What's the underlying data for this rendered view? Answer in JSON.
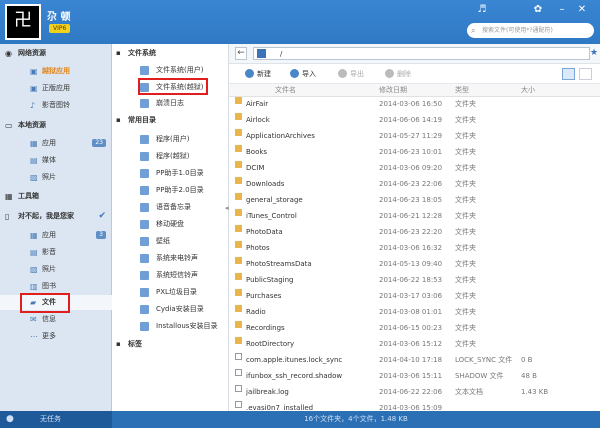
{
  "user": {
    "avatar_glyph": "卍",
    "name": "尕 顿",
    "vip": "VIP6"
  },
  "top_icons": {
    "music": "♬",
    "skin": "✿",
    "minimize": "–",
    "close": "✕"
  },
  "search": {
    "placeholder": "搜索文件(可使用*?通配符)",
    "icon": "search-icon"
  },
  "left_nav": {
    "network": {
      "label": "网络资源",
      "items": [
        {
          "label": "越狱应用",
          "active": true
        },
        {
          "label": "正版应用"
        },
        {
          "label": "影音图铃"
        }
      ]
    },
    "local": {
      "label": "本地资源",
      "items": [
        {
          "label": "应用",
          "badge": "23"
        },
        {
          "label": "媒体"
        },
        {
          "label": "照片"
        }
      ]
    },
    "toolbox": {
      "label": "工具箱"
    },
    "device": {
      "label": "对不起，我是您家",
      "items": [
        {
          "label": "应用",
          "badge": "3"
        },
        {
          "label": "影音"
        },
        {
          "label": "照片"
        },
        {
          "label": "图书"
        },
        {
          "label": "文件",
          "selected": true
        },
        {
          "label": "信息"
        },
        {
          "label": "更多"
        }
      ]
    }
  },
  "bottom_left": {
    "label": "无任务"
  },
  "tree": {
    "fs_header": "文件系统",
    "fs_items": [
      "文件系统(用户)",
      "文件系统(越狱)",
      "崩溃日志"
    ],
    "common_header": "常用目录",
    "common_items": [
      "程序(用户)",
      "程序(越狱)",
      "PP助手1.0目录",
      "PP助手2.0目录",
      "语音备忘录",
      "移动硬盘",
      "壁纸",
      "系统来电铃声",
      "系统短信铃声",
      "PXL垃圾目录",
      "Cydia安装目录",
      "Installous安装目录"
    ],
    "tags_header": "标签"
  },
  "path": {
    "value": "/"
  },
  "toolbar": {
    "new": "新建",
    "import": "导入",
    "export": "导出",
    "delete": "删除"
  },
  "columns": {
    "name": "文件名",
    "date": "修改日期",
    "type": "类型",
    "size": "大小"
  },
  "files": [
    {
      "name": "AirFair",
      "date": "2014-03-06 16:50",
      "type": "文件夹",
      "size": "",
      "folder": true
    },
    {
      "name": "Airlock",
      "date": "2014-06-06 14:19",
      "type": "文件夹",
      "size": "",
      "folder": true
    },
    {
      "name": "ApplicationArchives",
      "date": "2014-05-27 11:29",
      "type": "文件夹",
      "size": "",
      "folder": true
    },
    {
      "name": "Books",
      "date": "2014-06-23 10:01",
      "type": "文件夹",
      "size": "",
      "folder": true
    },
    {
      "name": "DCIM",
      "date": "2014-03-06 09:20",
      "type": "文件夹",
      "size": "",
      "folder": true
    },
    {
      "name": "Downloads",
      "date": "2014-06-23 22:06",
      "type": "文件夹",
      "size": "",
      "folder": true
    },
    {
      "name": "general_storage",
      "date": "2014-06-23 18:05",
      "type": "文件夹",
      "size": "",
      "folder": true
    },
    {
      "name": "iTunes_Control",
      "date": "2014-06-21 12:28",
      "type": "文件夹",
      "size": "",
      "folder": true
    },
    {
      "name": "PhotoData",
      "date": "2014-06-23 22:20",
      "type": "文件夹",
      "size": "",
      "folder": true
    },
    {
      "name": "Photos",
      "date": "2014-03-06 16:32",
      "type": "文件夹",
      "size": "",
      "folder": true
    },
    {
      "name": "PhotoStreamsData",
      "date": "2014-05-13 09:40",
      "type": "文件夹",
      "size": "",
      "folder": true
    },
    {
      "name": "PublicStaging",
      "date": "2014-06-22 18:53",
      "type": "文件夹",
      "size": "",
      "folder": true
    },
    {
      "name": "Purchases",
      "date": "2014-03-17 03:06",
      "type": "文件夹",
      "size": "",
      "folder": true
    },
    {
      "name": "Radio",
      "date": "2014-03-08 01:01",
      "type": "文件夹",
      "size": "",
      "folder": true
    },
    {
      "name": "Recordings",
      "date": "2014-06-15 00:23",
      "type": "文件夹",
      "size": "",
      "folder": true
    },
    {
      "name": "RootDirectory",
      "date": "2014-03-06 15:12",
      "type": "文件夹",
      "size": "",
      "folder": true
    },
    {
      "name": "com.apple.itunes.lock_sync",
      "date": "2014-04-10 17:18",
      "type": "LOCK_SYNC 文件",
      "size": "0 B",
      "folder": false
    },
    {
      "name": "ifunbox_ssh_record.shadow",
      "date": "2014-03-06 15:11",
      "type": "SHADOW 文件",
      "size": "48 B",
      "folder": false
    },
    {
      "name": "jailbreak.log",
      "date": "2014-06-22 22:06",
      "type": "文本文档",
      "size": "1.43 KB",
      "folder": false
    },
    {
      "name": ".evasi0n7_installed",
      "date": "2014-03-06 15:09",
      "type": "",
      "size": "",
      "folder": false
    }
  ],
  "status": {
    "text": "16个文件夹，4个文件，1.48 KB"
  }
}
